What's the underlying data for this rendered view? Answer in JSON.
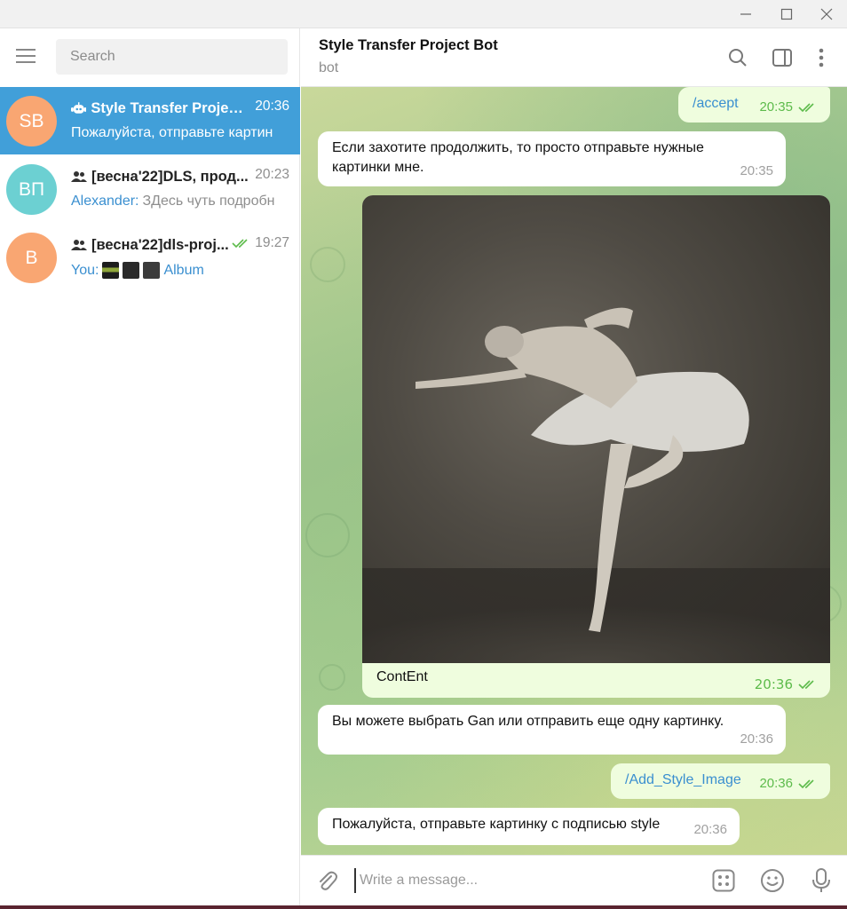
{
  "window": {
    "controls": [
      "minimize-icon",
      "maximize-icon",
      "close-icon"
    ]
  },
  "sidebar": {
    "search_placeholder": "Search",
    "chats": [
      {
        "initials": "SB",
        "title": "Style Transfer Project...",
        "time": "20:36",
        "preview": "Пожалуйста, отправьте картин",
        "avatar_color": "#f9a672",
        "type_icon": "bot-icon",
        "active": true
      },
      {
        "initials": "ВП",
        "title": "[весна'22]DLS, прод...",
        "time": "20:23",
        "sender": "Alexander:",
        "preview": "ЗДесь чуть подробн",
        "avatar_color": "#6cd0d2",
        "type_icon": "group-icon"
      },
      {
        "initials": "В",
        "title": "[весна'22]dls-proj...",
        "time": "19:27",
        "sender": "You:",
        "preview": "Album",
        "avatar_color": "#f9a672",
        "type_icon": "group-icon",
        "read_icon": "double-check-icon"
      }
    ]
  },
  "header": {
    "title": "Style Transfer Project Bot",
    "subtitle": "bot"
  },
  "messages": [
    {
      "dir": "out",
      "text": "/accept",
      "time": "20:35",
      "is_command": true
    },
    {
      "dir": "in",
      "text": "Если захотите продолжить, то просто отправьте нужные картинки мне.",
      "time": "20:35"
    },
    {
      "dir": "out",
      "type": "photo",
      "caption": "ContEnt",
      "time": "20:36"
    },
    {
      "dir": "in",
      "text": "Вы можете выбрать Gan или отправить еще одну картинку.",
      "time": "20:36"
    },
    {
      "dir": "out",
      "text": "/Add_Style_Image",
      "time": "20:36",
      "is_command": true
    },
    {
      "dir": "in",
      "text": "Пожалуйста, отправьте картинку с подписью style",
      "time": "20:36"
    }
  ],
  "composer": {
    "placeholder": "Write a message..."
  },
  "colors": {
    "accent": "#419fd9",
    "outgoing_bubble": "#effdde",
    "check": "#5dbb4b"
  }
}
